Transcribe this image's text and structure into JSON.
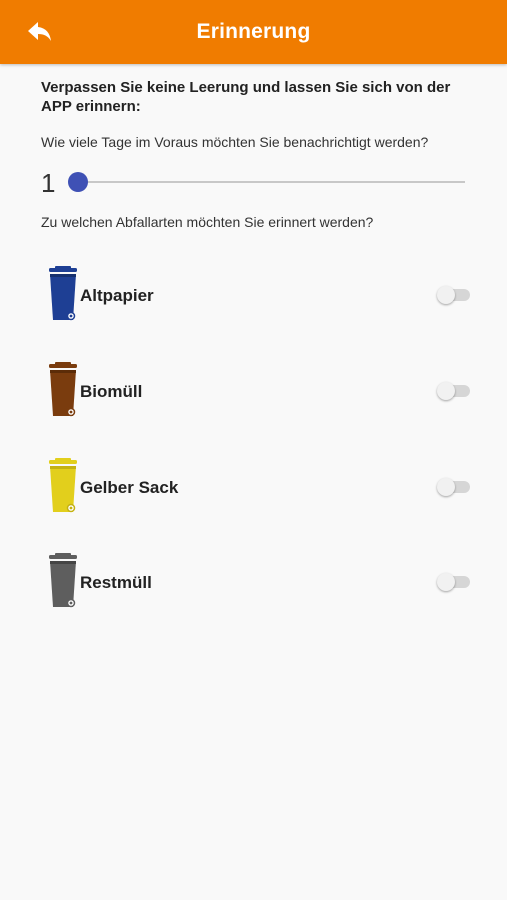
{
  "header": {
    "title": "Erinnerung",
    "back_icon": "back-arrow-icon",
    "color": "#f07c00"
  },
  "intro": {
    "text": "Verpassen Sie keine Leerung und lassen Sie sich von der APP erinnern:"
  },
  "days_question": "Wie viele Tage im Voraus möchten Sie benachrichtigt werden?",
  "days_slider": {
    "value": "1",
    "accent_color": "#3f51b5"
  },
  "types_question": "Zu welchen Abfallarten möchten Sie erinnert werden?",
  "waste_types": [
    {
      "label": "Altpapier",
      "icon": "blue-bin-icon",
      "color": "#1e3f94",
      "enabled": false
    },
    {
      "label": "Biomüll",
      "icon": "brown-bin-icon",
      "color": "#7a3c0e",
      "enabled": false
    },
    {
      "label": "Gelber Sack",
      "icon": "yellow-bin-icon",
      "color": "#e2cf1c",
      "enabled": false
    },
    {
      "label": "Restmüll",
      "icon": "grey-bin-icon",
      "color": "#5e5e5e",
      "enabled": false
    }
  ]
}
